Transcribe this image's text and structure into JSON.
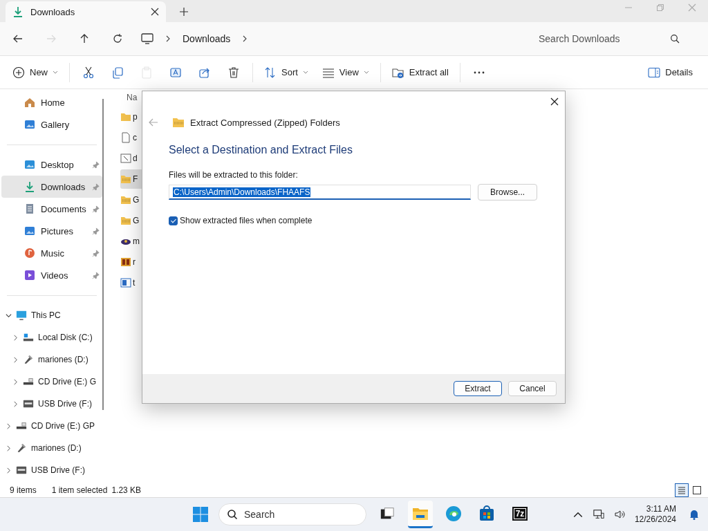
{
  "tab": {
    "title": "Downloads"
  },
  "nav_buttons": [
    {
      "kind": "back",
      "disabled": false
    },
    {
      "kind": "forward",
      "disabled": true
    },
    {
      "kind": "up",
      "disabled": false
    },
    {
      "kind": "refresh",
      "disabled": false
    }
  ],
  "breadcrumb": [
    "Downloads"
  ],
  "search": {
    "placeholder": "Search Downloads"
  },
  "toolbar": [
    {
      "kind": "new",
      "label": "New",
      "disabled": false
    },
    {
      "kind": "cut",
      "disabled": false
    },
    {
      "kind": "copy",
      "disabled": false
    },
    {
      "kind": "paste",
      "disabled": true
    },
    {
      "kind": "rename",
      "disabled": false
    },
    {
      "kind": "share",
      "disabled": false
    },
    {
      "kind": "delete",
      "disabled": false
    },
    {
      "kind": "sort",
      "label": "Sort",
      "disabled": false
    },
    {
      "kind": "view",
      "label": "View",
      "disabled": false
    },
    {
      "kind": "extract",
      "label": "Extract all",
      "disabled": false
    },
    {
      "kind": "more",
      "disabled": false
    }
  ],
  "details_button": {
    "label": "Details"
  },
  "sidebar": {
    "groups": [
      {
        "items": [
          {
            "kind": "home",
            "label": "Home",
            "selected": false
          },
          {
            "kind": "gallery",
            "label": "Gallery",
            "selected": false
          }
        ]
      },
      {
        "items": [
          {
            "kind": "desktop",
            "label": "Desktop",
            "selected": false,
            "pinned": true
          },
          {
            "kind": "downloads",
            "label": "Downloads",
            "selected": true,
            "pinned": true
          },
          {
            "kind": "documents",
            "label": "Documents",
            "selected": false,
            "pinned": true
          },
          {
            "kind": "pictures",
            "label": "Pictures",
            "selected": false,
            "pinned": true
          },
          {
            "kind": "music",
            "label": "Music",
            "selected": false,
            "pinned": true
          },
          {
            "kind": "videos",
            "label": "Videos",
            "selected": false,
            "pinned": true
          }
        ]
      },
      {
        "tree": [
          {
            "kind": "pc",
            "label": "This PC",
            "expanded": true,
            "children": [
              {
                "kind": "disk",
                "label": "Local Disk (C:)",
                "expanded": false
              },
              {
                "kind": "usb",
                "label": "mariones (D:)",
                "expanded": false
              },
              {
                "kind": "cd",
                "label": "CD Drive (E:) G",
                "expanded": false
              },
              {
                "kind": "drive",
                "label": "USB Drive (F:)",
                "expanded": false
              }
            ]
          },
          {
            "kind": "cd",
            "label": "CD Drive (E:) GP",
            "expanded": false
          },
          {
            "kind": "usb",
            "label": "mariones (D:)",
            "expanded": false
          },
          {
            "kind": "drive",
            "label": "USB Drive (F:)",
            "expanded": false
          }
        ]
      }
    ]
  },
  "files": {
    "header": "Na",
    "rows": [
      {
        "kind": "folder",
        "name": "p",
        "selected": false
      },
      {
        "kind": "file",
        "name": "c",
        "selected": false
      },
      {
        "kind": "shortcut",
        "name": "d",
        "selected": false
      },
      {
        "kind": "zip",
        "name": "F",
        "selected": true
      },
      {
        "kind": "zip",
        "name": "G",
        "selected": false
      },
      {
        "kind": "zip",
        "name": "G",
        "selected": false
      },
      {
        "kind": "app",
        "name": "m",
        "selected": false
      },
      {
        "kind": "rh",
        "name": "r",
        "selected": false
      },
      {
        "kind": "image",
        "name": "t",
        "selected": false
      }
    ]
  },
  "status_bar": {
    "count": "9 items",
    "selection": "1 item selected",
    "size": "1.23 KB",
    "views": [
      {
        "kind": "details",
        "selected": true
      },
      {
        "kind": "tiles",
        "selected": false
      }
    ]
  },
  "dialog": {
    "title": "Extract Compressed (Zipped) Folders",
    "heading": "Select a Destination and Extract Files",
    "field_label": "Files will be extracted to this folder:",
    "path": "C:\\Users\\Admin\\Downloads\\FHAAFS",
    "browse": "Browse...",
    "checkbox": {
      "label": "Show extracted files when complete",
      "checked": true
    },
    "buttons": [
      {
        "label": "Extract",
        "default": true
      },
      {
        "label": "Cancel",
        "default": false
      }
    ]
  },
  "taskbar": {
    "search_placeholder": "Search",
    "apps": [
      {
        "kind": "taskview",
        "active": false
      },
      {
        "kind": "explorer",
        "active": true
      },
      {
        "kind": "edge",
        "active": false
      },
      {
        "kind": "store",
        "active": false
      },
      {
        "kind": "sevenzip",
        "label": "7z",
        "active": false
      }
    ],
    "time": "3:11 AM",
    "date": "12/26/2024"
  }
}
